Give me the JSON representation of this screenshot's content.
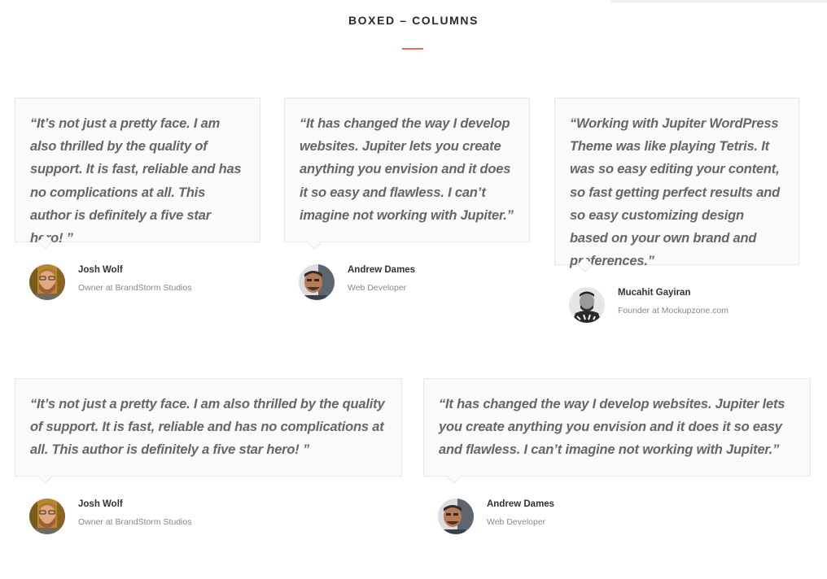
{
  "section": {
    "title": "BOXED – COLUMNS"
  },
  "colors": {
    "accent": "#e36d4f",
    "quote_text": "#666666",
    "box_bg": "#fafafa"
  },
  "testimonials_row1": [
    {
      "quote": "“It’s not just a pretty face. I am also thrilled by the quality of support. It is fast, reliable and has no complications at all. This author is definitely a five star hero! ”",
      "name": "Josh Wolf",
      "role": "Owner at BrandStorm Studios",
      "avatar": "josh-wolf-avatar"
    },
    {
      "quote": "“It has changed the way I develop websites. Jupiter lets you create anything you envision and it does it so easy and flawless. I can’t imagine not working with Jupiter.”",
      "name": "Andrew Dames",
      "role": "Web Developer",
      "avatar": "andrew-dames-avatar"
    },
    {
      "quote": "“Working with Jupiter WordPress Theme was like playing Tetris. It was so easy editing your content, so fast getting perfect results and so easy customizing design based on your own brand and preferences.”",
      "name": "Mucahit Gayiran",
      "role": "Founder at Mockupzone.com",
      "avatar": "mucahit-gayiran-avatar"
    }
  ],
  "testimonials_row2": [
    {
      "quote": "“It’s not just a pretty face. I am also thrilled by the quality of support. It is fast, reliable and has no complications at all. This author is definitely a five star hero! ”",
      "name": "Josh Wolf",
      "role": "Owner at BrandStorm Studios",
      "avatar": "josh-wolf-avatar"
    },
    {
      "quote": "“It has changed the way I develop websites. Jupiter lets you create anything you envision and it does it so easy and flawless. I can’t imagine not working with Jupiter.”",
      "name": "Andrew Dames",
      "role": "Web Developer",
      "avatar": "andrew-dames-avatar"
    }
  ]
}
